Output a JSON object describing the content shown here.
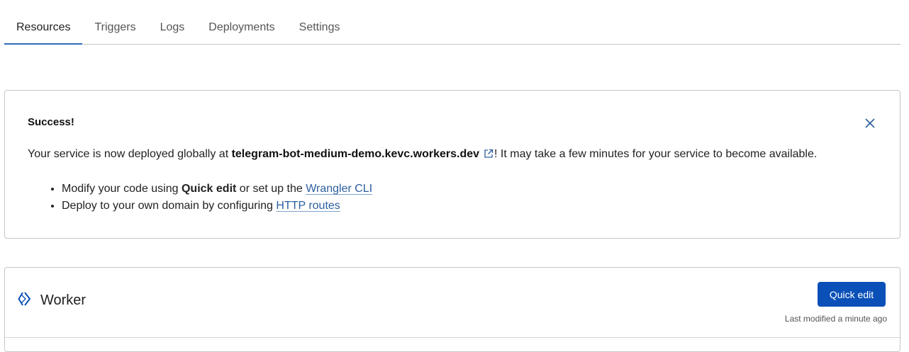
{
  "tabs": [
    {
      "label": "Resources",
      "active": true
    },
    {
      "label": "Triggers"
    },
    {
      "label": "Logs"
    },
    {
      "label": "Deployments"
    },
    {
      "label": "Settings"
    }
  ],
  "success": {
    "title": "Success!",
    "msg_prefix": "Your service is now deployed globally at ",
    "domain": "telegram-bot-medium-demo.kevc.workers.dev",
    "msg_suffix": "! It may take a few minutes for your service to become available.",
    "bullets": [
      {
        "prefix": "Modify your code using ",
        "bold": "Quick edit",
        "middle": " or set up the ",
        "link": "Wrangler CLI"
      },
      {
        "prefix": "Deploy to your own domain by configuring ",
        "link": "HTTP routes"
      }
    ]
  },
  "worker": {
    "title": "Worker",
    "quick_edit_label": "Quick edit",
    "last_modified": "Last modified a minute ago"
  },
  "colors": {
    "accent": "#0b50b8",
    "tab_underline": "#2f6cb8",
    "link": "#2c5f9e"
  },
  "icons": [
    "external-link-icon",
    "close-icon",
    "worker-logo-icon"
  ]
}
